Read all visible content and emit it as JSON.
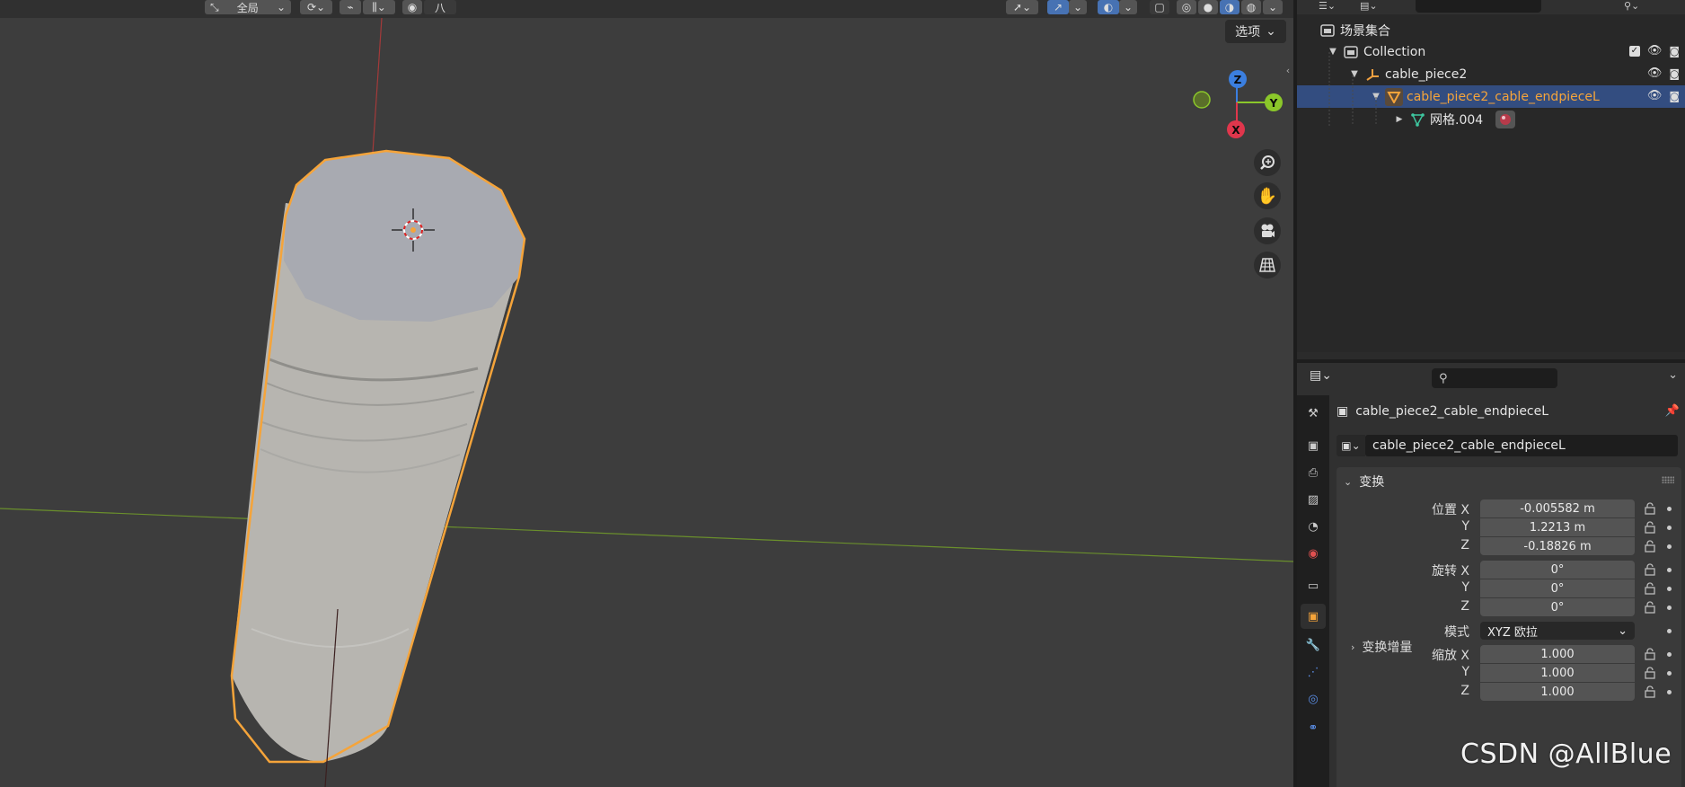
{
  "viewport": {
    "header": {
      "transform_orientation": "全局",
      "snap_label": "八"
    },
    "options_label": "选项",
    "gizmo": {
      "z": "Z",
      "y": "Y",
      "x": "X"
    },
    "nav_icons": [
      "zoom-icon",
      "hand-pan-icon",
      "camera-icon",
      "grid-icon"
    ]
  },
  "outliner": {
    "rows": [
      {
        "label": "场景集合",
        "icon": "scene-collection-icon"
      },
      {
        "label": "Collection",
        "icon": "collection-icon"
      },
      {
        "label": "cable_piece2",
        "icon": "empty-icon"
      },
      {
        "label": "cable_piece2_cable_endpieceL",
        "icon": "mesh-object-icon",
        "selected": true
      },
      {
        "label": "网格.004",
        "icon": "mesh-data-icon"
      }
    ]
  },
  "properties": {
    "object_name": "cable_piece2_cable_endpieceL",
    "name_field_value": "cable_piece2_cable_endpieceL",
    "transform_panel_title": "变换",
    "location": {
      "label": "位置 X",
      "x": "-0.005582 m",
      "y_label": "Y",
      "y": "1.2213 m",
      "z_label": "Z",
      "z": "-0.18826 m"
    },
    "rotation": {
      "label": "旋转 X",
      "x": "0°",
      "y_label": "Y",
      "y": "0°",
      "z_label": "Z",
      "z": "0°"
    },
    "mode": {
      "label": "模式",
      "value": "XYZ 欧拉"
    },
    "scale": {
      "label": "缩放 X",
      "x": "1.000",
      "y_label": "Y",
      "y": "1.000",
      "z_label": "Z",
      "z": "1.000"
    },
    "delta_label": "变换增量"
  },
  "watermark": "CSDN @AllBlue",
  "colors": {
    "accent_blue": "#4772b3",
    "selection_orange": "#f5a43a",
    "axis_x": "#e0364c",
    "axis_y": "#8bc72a",
    "axis_z": "#3b7fe0"
  }
}
